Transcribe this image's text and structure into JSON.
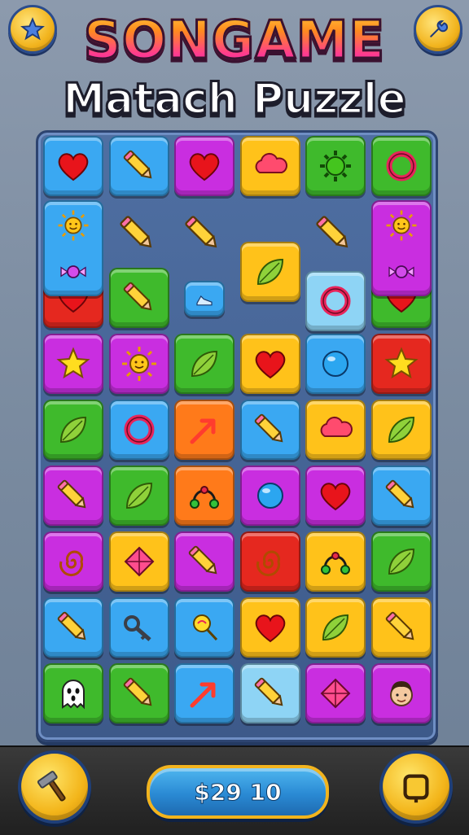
{
  "header": {
    "title": "SONGAME",
    "subtitle": "Matach Puzzle",
    "left_button_icon": "star-icon",
    "right_button_icon": "settings-icon"
  },
  "footer": {
    "coins_label": "$29 10",
    "left_button_icon": "hammer-icon",
    "right_button_icon": "menu-square-icon"
  },
  "colors": {
    "blue": "#3aa8f2",
    "yellow": "#ffc21a",
    "magenta": "#c92ee0",
    "green": "#3fba2c",
    "red": "#e5281f",
    "orange": "#ff7a1a",
    "lightblue": "#8ed4f5"
  },
  "board": {
    "rows": 9,
    "cols": 6,
    "tiles": [
      {
        "r": 0,
        "c": 0,
        "color": "blue",
        "icon": "heart"
      },
      {
        "r": 0,
        "c": 1,
        "color": "blue",
        "icon": "pencil"
      },
      {
        "r": 0,
        "c": 2,
        "color": "magenta",
        "icon": "heart"
      },
      {
        "r": 0,
        "c": 3,
        "color": "yellow",
        "icon": "cloud"
      },
      {
        "r": 0,
        "c": 4,
        "color": "green",
        "icon": "gear"
      },
      {
        "r": 0,
        "c": 5,
        "color": "green",
        "icon": "ring"
      },
      {
        "r": 2,
        "c": 0,
        "color": "red",
        "icon": "heart"
      },
      {
        "r": 2,
        "c": 1,
        "color": "green",
        "icon": "pencil"
      },
      {
        "r": 2,
        "c": 5,
        "color": "green",
        "icon": "heart"
      },
      {
        "r": 3,
        "c": 0,
        "color": "magenta",
        "icon": "star"
      },
      {
        "r": 3,
        "c": 1,
        "color": "magenta",
        "icon": "sun"
      },
      {
        "r": 3,
        "c": 2,
        "color": "green",
        "icon": "leaf"
      },
      {
        "r": 3,
        "c": 3,
        "color": "yellow",
        "icon": "heart"
      },
      {
        "r": 3,
        "c": 4,
        "color": "blue",
        "icon": "ball"
      },
      {
        "r": 3,
        "c": 5,
        "color": "red",
        "icon": "star"
      },
      {
        "r": 4,
        "c": 0,
        "color": "green",
        "icon": "leaf"
      },
      {
        "r": 4,
        "c": 1,
        "color": "blue",
        "icon": "ring"
      },
      {
        "r": 4,
        "c": 2,
        "color": "orange",
        "icon": "arrow"
      },
      {
        "r": 4,
        "c": 3,
        "color": "blue",
        "icon": "pencil"
      },
      {
        "r": 4,
        "c": 4,
        "color": "yellow",
        "icon": "cloud"
      },
      {
        "r": 4,
        "c": 5,
        "color": "yellow",
        "icon": "leaf"
      },
      {
        "r": 5,
        "c": 0,
        "color": "magenta",
        "icon": "pencil"
      },
      {
        "r": 5,
        "c": 1,
        "color": "green",
        "icon": "leaf"
      },
      {
        "r": 5,
        "c": 2,
        "color": "orange",
        "icon": "knot"
      },
      {
        "r": 5,
        "c": 3,
        "color": "magenta",
        "icon": "ball"
      },
      {
        "r": 5,
        "c": 4,
        "color": "magenta",
        "icon": "heart"
      },
      {
        "r": 5,
        "c": 5,
        "color": "blue",
        "icon": "pencil"
      },
      {
        "r": 6,
        "c": 0,
        "color": "magenta",
        "icon": "spiral"
      },
      {
        "r": 6,
        "c": 1,
        "color": "yellow",
        "icon": "kite"
      },
      {
        "r": 6,
        "c": 2,
        "color": "magenta",
        "icon": "pencil"
      },
      {
        "r": 6,
        "c": 3,
        "color": "red",
        "icon": "spiral"
      },
      {
        "r": 6,
        "c": 4,
        "color": "yellow",
        "icon": "knot"
      },
      {
        "r": 6,
        "c": 5,
        "color": "green",
        "icon": "leaf"
      },
      {
        "r": 7,
        "c": 0,
        "color": "blue",
        "icon": "pencil"
      },
      {
        "r": 7,
        "c": 1,
        "color": "blue",
        "icon": "key"
      },
      {
        "r": 7,
        "c": 2,
        "color": "blue",
        "icon": "lollipop"
      },
      {
        "r": 7,
        "c": 3,
        "color": "yellow",
        "icon": "heart"
      },
      {
        "r": 7,
        "c": 4,
        "color": "yellow",
        "icon": "leaf"
      },
      {
        "r": 7,
        "c": 5,
        "color": "yellow",
        "icon": "pencil"
      },
      {
        "r": 8,
        "c": 0,
        "color": "green",
        "icon": "ghost"
      },
      {
        "r": 8,
        "c": 1,
        "color": "green",
        "icon": "pencil"
      },
      {
        "r": 8,
        "c": 2,
        "color": "blue",
        "icon": "arrow"
      },
      {
        "r": 8,
        "c": 3,
        "color": "lightblue",
        "icon": "pencil"
      },
      {
        "r": 8,
        "c": 4,
        "color": "magenta",
        "icon": "kite"
      },
      {
        "r": 8,
        "c": 5,
        "color": "magenta",
        "icon": "face"
      }
    ],
    "tall_tiles": [
      {
        "r": 1,
        "c": 0,
        "color": "blue",
        "icons": [
          "sun",
          "candy"
        ]
      },
      {
        "r": 1,
        "c": 5,
        "color": "magenta",
        "icons": [
          "sun",
          "candy"
        ]
      }
    ],
    "loose_pieces": [
      {
        "r": 1,
        "c": 1,
        "icon": "pencil"
      },
      {
        "r": 1,
        "c": 2,
        "icon": "pencil"
      },
      {
        "r": 1,
        "c": 4,
        "icon": "pencil"
      },
      {
        "r": 1.55,
        "c": 3,
        "icon": "leaf",
        "color": "yellow",
        "tile": true
      },
      {
        "r": 2,
        "c": 2,
        "icon": "shoe",
        "color": "blue",
        "tile": true,
        "small": true
      },
      {
        "r": 2,
        "c": 4,
        "icon": "ring",
        "color": "lightblue",
        "tile": true
      }
    ]
  }
}
